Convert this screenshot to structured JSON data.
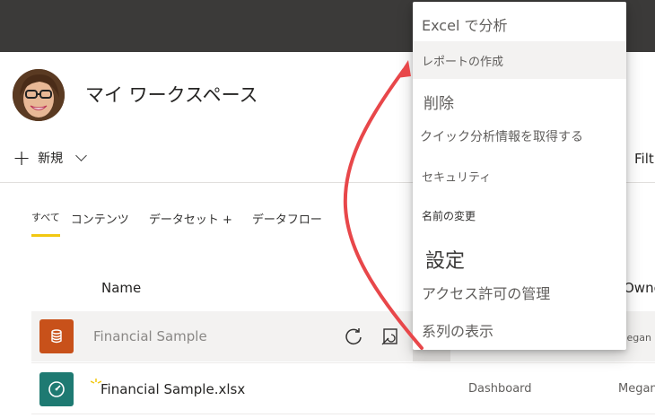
{
  "workspace": {
    "title": "マイ ワークスペース"
  },
  "toolbar": {
    "new_label": "新規",
    "filter_label": "Filt"
  },
  "tabs": [
    {
      "label": "すべて",
      "active": true
    },
    {
      "label": "コンテンツ"
    },
    {
      "label": "データセット +"
    },
    {
      "label": "データフロー"
    }
  ],
  "table": {
    "headers": {
      "name": "Name",
      "owner": "Owne"
    },
    "rows": [
      {
        "name": "Financial Sample",
        "type": "",
        "owner": "Megan",
        "icon": "dataset-icon",
        "highlighted": true
      },
      {
        "name": "Financial Sample.xlsx",
        "type": "Dashboard",
        "owner": "Megan",
        "icon": "dashboard-icon",
        "highlighted": false
      }
    ]
  },
  "context_menu": {
    "items": [
      {
        "label": "Excel で分析"
      },
      {
        "label": "レポートの作成",
        "highlighted": true
      },
      {
        "label": "削除"
      },
      {
        "label": "クイック分析情報を取得する"
      },
      {
        "label": "セキュリティ"
      },
      {
        "label": "名前の変更"
      },
      {
        "label": "設定"
      },
      {
        "label": "アクセス許可の管理"
      },
      {
        "label": "系列の表示"
      }
    ]
  },
  "colors": {
    "topbar": "#3b3a39",
    "tab_underline": "#f2c811",
    "dataset_tile": "#c8511a",
    "dashboard_tile": "#1e7a72",
    "annotation_arrow": "#e8474a"
  }
}
